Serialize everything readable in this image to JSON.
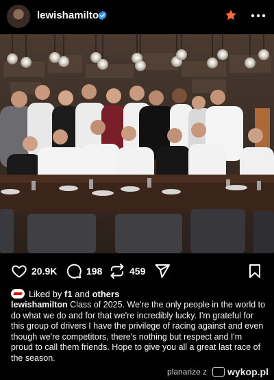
{
  "post": {
    "username": "lewishamilton",
    "verified": true
  },
  "actions": {
    "likes": "20.9K",
    "comments": "198",
    "reposts": "459"
  },
  "liked_by": {
    "prefix": "Liked by",
    "user": "f1",
    "joiner": "and",
    "others": "others"
  },
  "caption": {
    "username": "lewishamilton",
    "text": "Class of 2025. We're the only people in the world to do what we do and for that we're incredibly lucky. I'm grateful for this group of drivers I have the privilege of racing against and even though we're competitors, there's nothing but respect and I'm proud to call them friends. Hope to give you all a great last race of the season."
  },
  "watermark": {
    "user": "planarize",
    "sep": "z",
    "site": "wykop.pl"
  },
  "colors": {
    "accent_star": "#ff6a3d",
    "verified": "#3797f0",
    "background": "#000000"
  }
}
